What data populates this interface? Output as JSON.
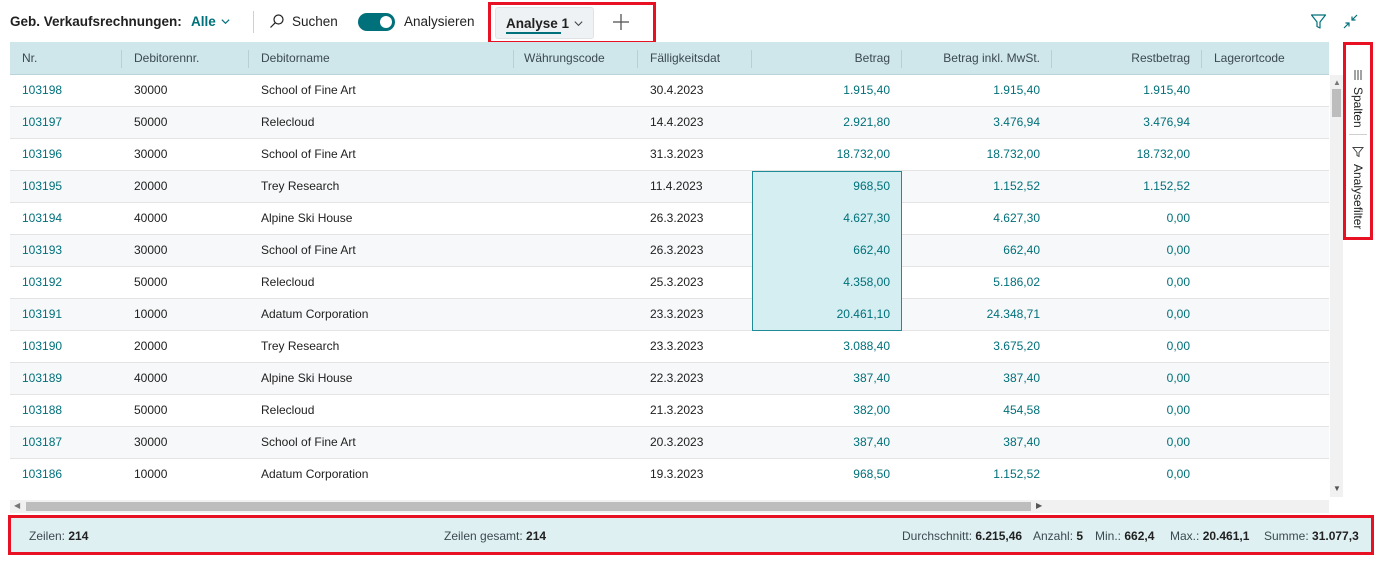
{
  "toolbar": {
    "page_caption": "Geb. Verkaufsrechnungen:",
    "view_selector": "Alle",
    "search_label": "Suchen",
    "analyze_label": "Analysieren",
    "analyze_on": true,
    "analysis_tab": "Analyse 1",
    "accent_color": "#00707a",
    "highlight_color": "#e81123"
  },
  "grid": {
    "columns": [
      "Nr.",
      "Debitorennr.",
      "Debitorname",
      "Währungscode",
      "Fälligkeitsdat",
      "Betrag",
      "Betrag inkl. MwSt.",
      "Restbetrag",
      "Lagerortcode"
    ],
    "rows": [
      {
        "nr": "103198",
        "debitor": "30000",
        "name": "School of Fine Art",
        "currency": "",
        "due": "30.4.2023",
        "amount": "1.915,40",
        "amount_vat": "1.915,40",
        "remaining": "1.915,40",
        "location": ""
      },
      {
        "nr": "103197",
        "debitor": "50000",
        "name": "Relecloud",
        "currency": "",
        "due": "14.4.2023",
        "amount": "2.921,80",
        "amount_vat": "3.476,94",
        "remaining": "3.476,94",
        "location": ""
      },
      {
        "nr": "103196",
        "debitor": "30000",
        "name": "School of Fine Art",
        "currency": "",
        "due": "31.3.2023",
        "amount": "18.732,00",
        "amount_vat": "18.732,00",
        "remaining": "18.732,00",
        "location": ""
      },
      {
        "nr": "103195",
        "debitor": "20000",
        "name": "Trey Research",
        "currency": "",
        "due": "11.4.2023",
        "amount": "968,50",
        "amount_vat": "1.152,52",
        "remaining": "1.152,52",
        "location": ""
      },
      {
        "nr": "103194",
        "debitor": "40000",
        "name": "Alpine Ski House",
        "currency": "",
        "due": "26.3.2023",
        "amount": "4.627,30",
        "amount_vat": "4.627,30",
        "remaining": "0,00",
        "location": ""
      },
      {
        "nr": "103193",
        "debitor": "30000",
        "name": "School of Fine Art",
        "currency": "",
        "due": "26.3.2023",
        "amount": "662,40",
        "amount_vat": "662,40",
        "remaining": "0,00",
        "location": ""
      },
      {
        "nr": "103192",
        "debitor": "50000",
        "name": "Relecloud",
        "currency": "",
        "due": "25.3.2023",
        "amount": "4.358,00",
        "amount_vat": "5.186,02",
        "remaining": "0,00",
        "location": ""
      },
      {
        "nr": "103191",
        "debitor": "10000",
        "name": "Adatum Corporation",
        "currency": "",
        "due": "23.3.2023",
        "amount": "20.461,10",
        "amount_vat": "24.348,71",
        "remaining": "0,00",
        "location": ""
      },
      {
        "nr": "103190",
        "debitor": "20000",
        "name": "Trey Research",
        "currency": "",
        "due": "23.3.2023",
        "amount": "3.088,40",
        "amount_vat": "3.675,20",
        "remaining": "0,00",
        "location": ""
      },
      {
        "nr": "103189",
        "debitor": "40000",
        "name": "Alpine Ski House",
        "currency": "",
        "due": "22.3.2023",
        "amount": "387,40",
        "amount_vat": "387,40",
        "remaining": "0,00",
        "location": ""
      },
      {
        "nr": "103188",
        "debitor": "50000",
        "name": "Relecloud",
        "currency": "",
        "due": "21.3.2023",
        "amount": "382,00",
        "amount_vat": "454,58",
        "remaining": "0,00",
        "location": ""
      },
      {
        "nr": "103187",
        "debitor": "30000",
        "name": "School of Fine Art",
        "currency": "",
        "due": "20.3.2023",
        "amount": "387,40",
        "amount_vat": "387,40",
        "remaining": "0,00",
        "location": ""
      },
      {
        "nr": "103186",
        "debitor": "10000",
        "name": "Adatum Corporation",
        "currency": "",
        "due": "19.3.2023",
        "amount": "968,50",
        "amount_vat": "1.152,52",
        "remaining": "0,00",
        "location": ""
      }
    ],
    "selected_rows": [
      3,
      4,
      5,
      6,
      7
    ]
  },
  "side_pane": {
    "columns_label": "Spalten",
    "filters_label": "Analysefilter"
  },
  "status_bar": {
    "rows_label": "Zeilen:",
    "rows_value": "214",
    "total_label": "Zeilen gesamt:",
    "total_value": "214",
    "avg_label": "Durchschnitt:",
    "avg_value": "6.215,46",
    "count_label": "Anzahl:",
    "count_value": "5",
    "min_label": "Min.:",
    "min_value": "662,4",
    "max_label": "Max.:",
    "max_value": "20.461,1",
    "sum_label": "Summe:",
    "sum_value": "31.077,3"
  }
}
